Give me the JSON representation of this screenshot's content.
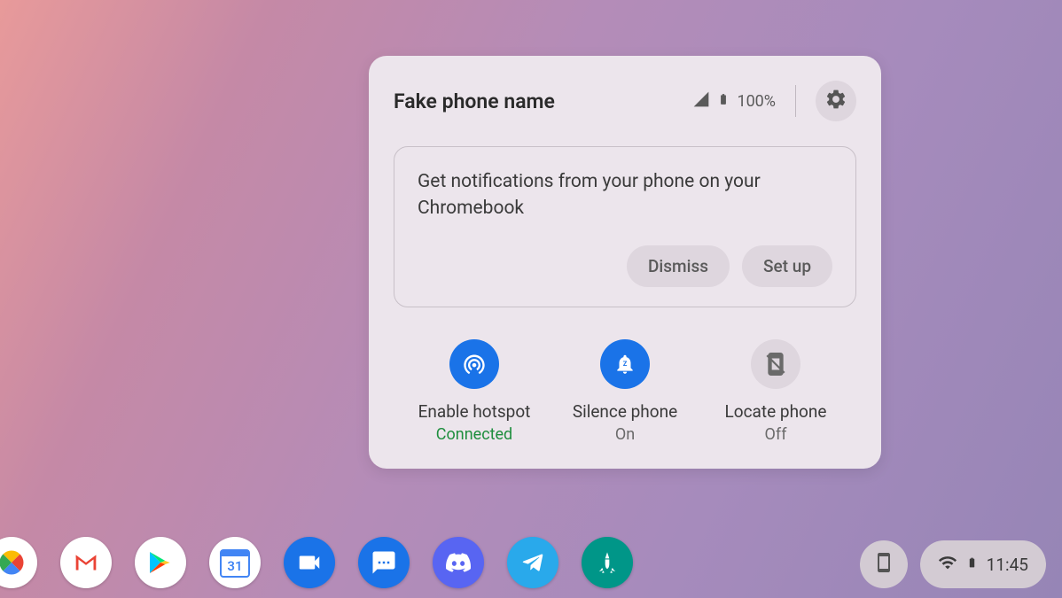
{
  "panel": {
    "title": "Fake phone name",
    "battery_pct": "100%",
    "notification": {
      "text": "Get notifications from your phone on your Chromebook",
      "dismiss": "Dismiss",
      "setup": "Set up"
    },
    "tiles": {
      "hotspot": {
        "label": "Enable hotspot",
        "status": "Connected"
      },
      "silence": {
        "label": "Silence phone",
        "status": "On"
      },
      "locate": {
        "label": "Locate phone",
        "status": "Off"
      }
    }
  },
  "shelf": {
    "apps": [
      "Photos",
      "Gmail",
      "Play Store",
      "Calendar",
      "Duo",
      "Messages",
      "Discord",
      "Telegram",
      "Squid"
    ],
    "calendar_day": "31",
    "clock": "11:45"
  }
}
